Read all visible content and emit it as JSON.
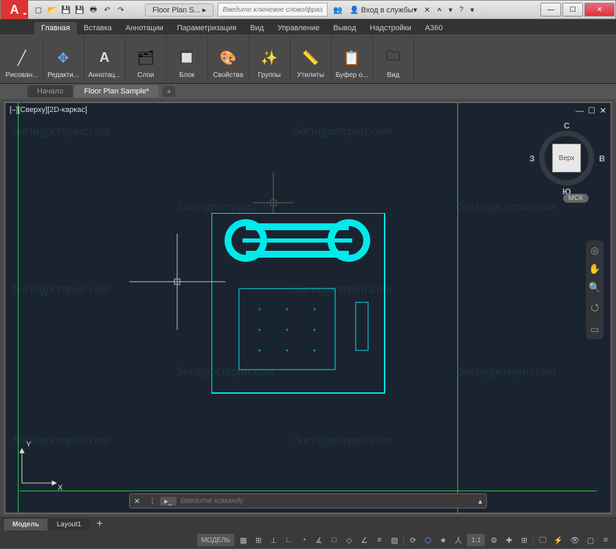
{
  "appInitial": "A",
  "qat": [
    "▢",
    "📄",
    "↷",
    "🖶",
    "↶",
    "↷"
  ],
  "titleTab": "Floor Plan S...",
  "searchPlaceholder": "Введите ключевое слово/фразу",
  "titleRight": {
    "signin": "Вход в службы",
    "help": "?"
  },
  "winControls": {
    "min": "—",
    "max": "☐",
    "close": "✕"
  },
  "ribbonTabs": [
    "Главная",
    "Вставка",
    "Аннотации",
    "Параметризация",
    "Вид",
    "Управление",
    "Вывод",
    "Надстройки",
    "A360"
  ],
  "activeRibbonTab": 0,
  "ribbonPanels": [
    {
      "icon": "╱",
      "label": "Рисован..."
    },
    {
      "icon": "✥",
      "label": "Редакти..."
    },
    {
      "icon": "A",
      "label": "Аннотац..."
    },
    {
      "icon": "▤",
      "label": "Слои"
    },
    {
      "icon": "▣",
      "label": "Блок"
    },
    {
      "icon": "◧",
      "label": "Свойства"
    },
    {
      "icon": "✦",
      "label": "Группы"
    },
    {
      "icon": "↔",
      "label": "Утилиты"
    },
    {
      "icon": "📋",
      "label": "Буфер о..."
    },
    {
      "icon": "▭",
      "label": "Вид"
    }
  ],
  "docTabs": [
    "Начало",
    "Floor Plan Sample*"
  ],
  "activeDocTab": 1,
  "viewportLabel": "[–][Сверху][2D-каркас]",
  "viewControls": {
    "min": "—",
    "max": "☐",
    "close": "✕"
  },
  "viewcube": {
    "face": "Верх",
    "n": "С",
    "s": "Ю",
    "e": "В",
    "w": "З",
    "label": "МСК"
  },
  "ucs": {
    "x": "X",
    "y": "Y"
  },
  "cmdPlaceholder": "Введите команду",
  "layoutTabs": [
    "Модель",
    "Layout1"
  ],
  "activeLayoutTab": 0,
  "statusbar": {
    "model": "МОДЕЛЬ",
    "ratio": "1:1"
  },
  "watermark": "Soringpcrepair.com"
}
